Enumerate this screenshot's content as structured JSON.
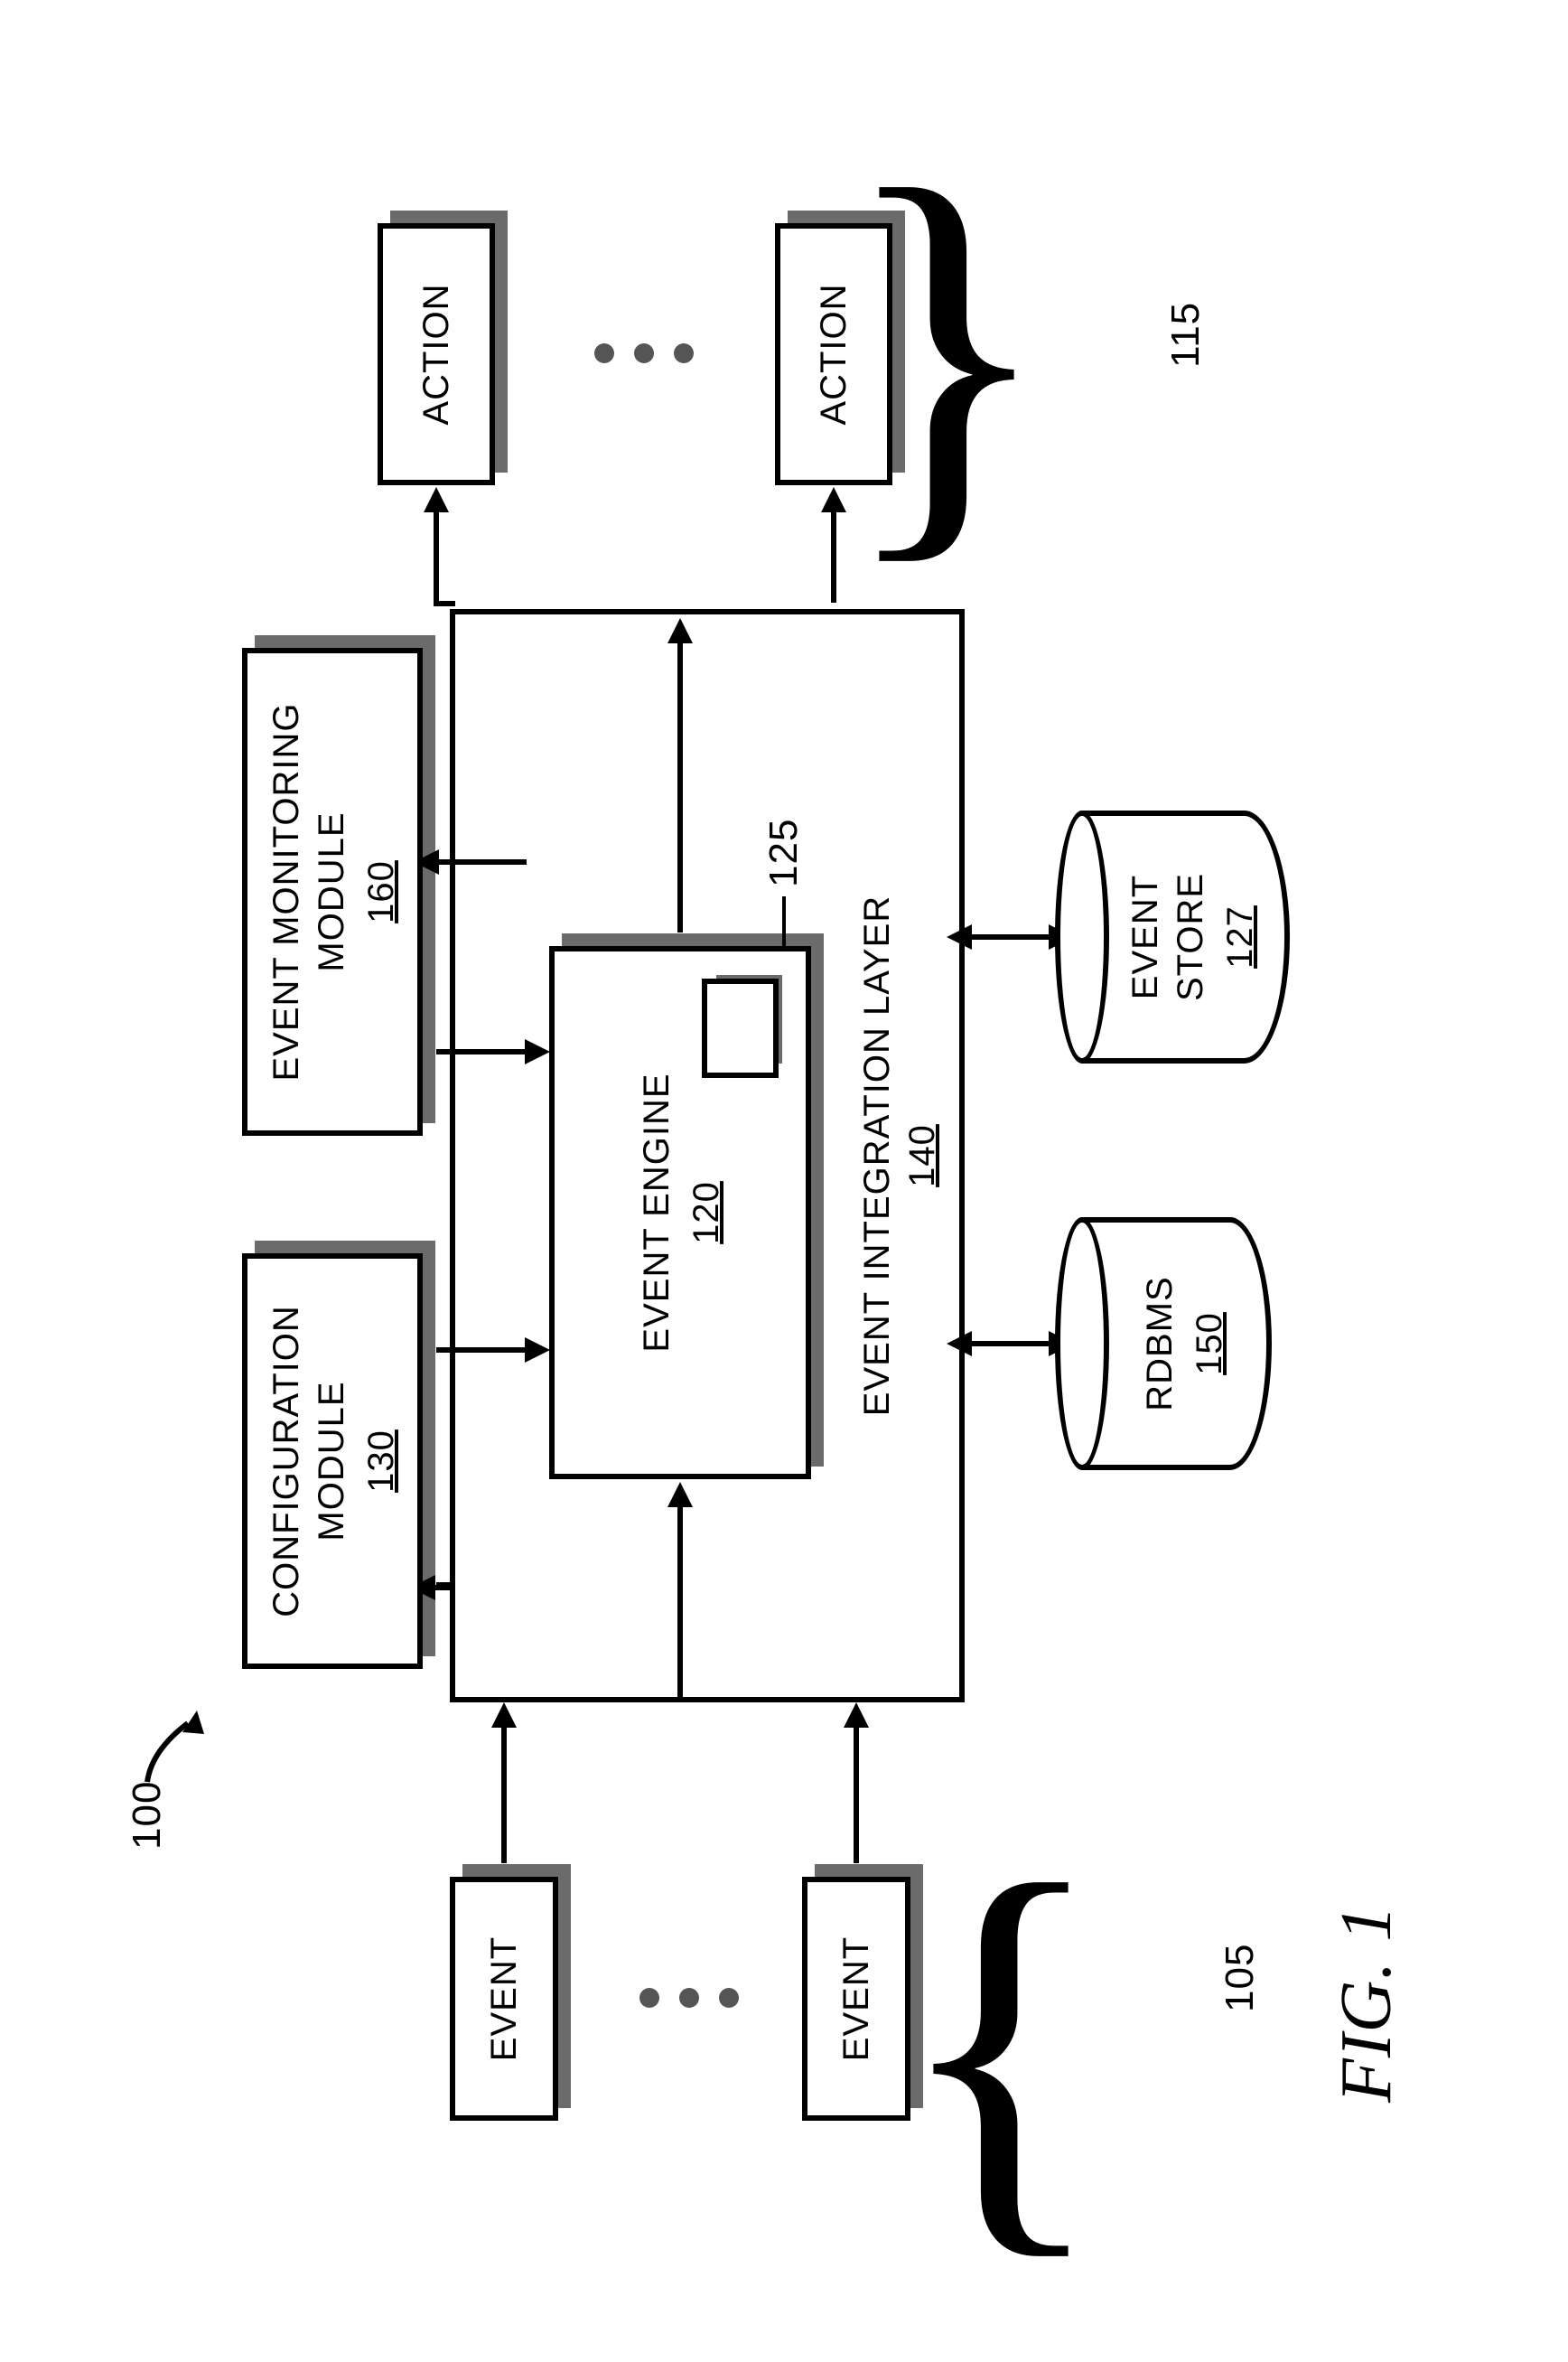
{
  "figure": {
    "system_ref": "100",
    "caption": "FIG. 1"
  },
  "groups": {
    "inputs_ref": "105",
    "outputs_ref": "115"
  },
  "boxes": {
    "event": "EVENT",
    "action": "ACTION",
    "config": {
      "title": "CONFIGURATION\nMODULE",
      "num": "130"
    },
    "monitor": {
      "title": "EVENT MONITORING\nMODULE",
      "num": "160"
    },
    "engine": {
      "title": "EVENT ENGINE",
      "num": "120",
      "inner_ref": "125"
    },
    "integration": {
      "title": "EVENT INTEGRATION LAYER",
      "num": "140"
    }
  },
  "cylinders": {
    "rdbms": {
      "title": "RDBMS",
      "num": "150"
    },
    "event_store": {
      "title": "EVENT\nSTORE",
      "num": "127"
    }
  }
}
